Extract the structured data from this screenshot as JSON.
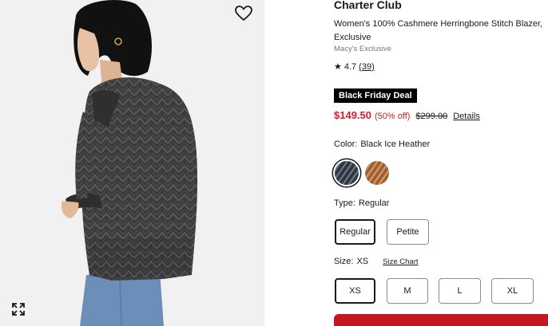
{
  "product": {
    "brand": "Charter Club",
    "title": "Women's 100% Cashmere Herringbone Stitch Blazer, Exclusive",
    "exclusive_label": "Macy's Exclusive",
    "rating": {
      "star_icon": "star-icon",
      "value": "4.7",
      "count": "(39)"
    }
  },
  "pricing": {
    "deal_badge": "Black Friday Deal",
    "sale_price": "$149.50",
    "discount": "(50% off)",
    "original_price": "$299.00",
    "details_link": "Details"
  },
  "color": {
    "label": "Color:",
    "selected": "Black Ice Heather",
    "swatches": [
      {
        "name": "Black Ice Heather",
        "hex": "#3a3f4a"
      },
      {
        "name": "Camel",
        "hex": "#b57848"
      }
    ]
  },
  "type": {
    "label": "Type:",
    "selected": "Regular",
    "options": [
      "Regular",
      "Petite"
    ]
  },
  "size": {
    "label": "Size:",
    "selected": "XS",
    "chart_link": "Size Chart",
    "options": [
      "XS",
      "M",
      "L",
      "XL"
    ]
  },
  "icons": {
    "wishlist": "heart-icon",
    "expand": "expand-icon"
  },
  "colors": {
    "sale_red": "#d11e2c",
    "add_to_bag": "#c4171f"
  }
}
